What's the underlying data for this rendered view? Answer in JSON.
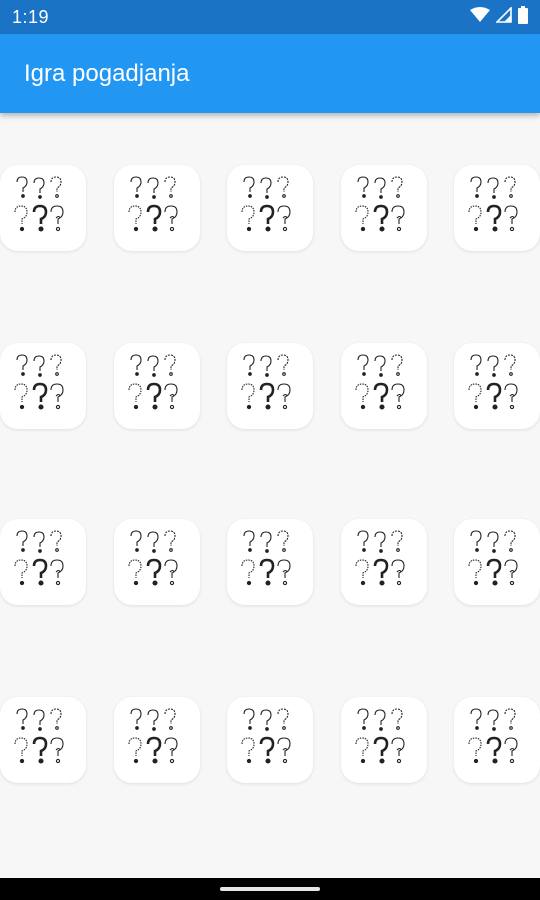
{
  "status_bar": {
    "time": "1:19",
    "icons": [
      "wifi-icon",
      "signal-icon",
      "battery-icon"
    ]
  },
  "app_bar": {
    "title": "Igra pogadjanja",
    "color": "#2196f3"
  },
  "grid": {
    "rows": 4,
    "columns": 5,
    "card_icon": "question-marks-icon"
  },
  "colors": {
    "status_bar": "#1a73c5",
    "app_bar": "#2196f3",
    "background": "#f7f7f7",
    "card": "#ffffff"
  }
}
